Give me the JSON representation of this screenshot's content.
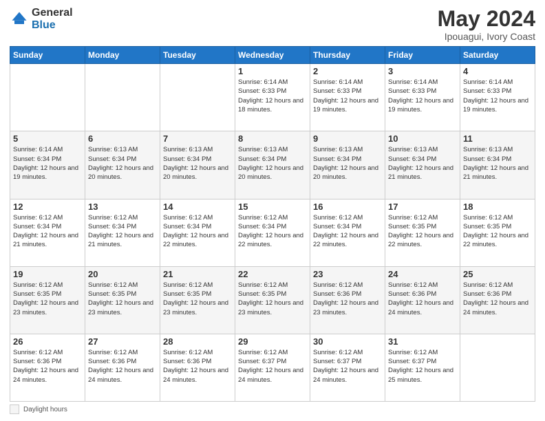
{
  "logo": {
    "general": "General",
    "blue": "Blue"
  },
  "title": "May 2024",
  "subtitle": "Ipouagui, Ivory Coast",
  "days_header": [
    "Sunday",
    "Monday",
    "Tuesday",
    "Wednesday",
    "Thursday",
    "Friday",
    "Saturday"
  ],
  "footer": {
    "daylight_label": "Daylight hours"
  },
  "weeks": [
    [
      {
        "day": "",
        "info": ""
      },
      {
        "day": "",
        "info": ""
      },
      {
        "day": "",
        "info": ""
      },
      {
        "day": "1",
        "info": "Sunrise: 6:14 AM\nSunset: 6:33 PM\nDaylight: 12 hours\nand 18 minutes."
      },
      {
        "day": "2",
        "info": "Sunrise: 6:14 AM\nSunset: 6:33 PM\nDaylight: 12 hours\nand 19 minutes."
      },
      {
        "day": "3",
        "info": "Sunrise: 6:14 AM\nSunset: 6:33 PM\nDaylight: 12 hours\nand 19 minutes."
      },
      {
        "day": "4",
        "info": "Sunrise: 6:14 AM\nSunset: 6:33 PM\nDaylight: 12 hours\nand 19 minutes."
      }
    ],
    [
      {
        "day": "5",
        "info": "Sunrise: 6:14 AM\nSunset: 6:34 PM\nDaylight: 12 hours\nand 19 minutes."
      },
      {
        "day": "6",
        "info": "Sunrise: 6:13 AM\nSunset: 6:34 PM\nDaylight: 12 hours\nand 20 minutes."
      },
      {
        "day": "7",
        "info": "Sunrise: 6:13 AM\nSunset: 6:34 PM\nDaylight: 12 hours\nand 20 minutes."
      },
      {
        "day": "8",
        "info": "Sunrise: 6:13 AM\nSunset: 6:34 PM\nDaylight: 12 hours\nand 20 minutes."
      },
      {
        "day": "9",
        "info": "Sunrise: 6:13 AM\nSunset: 6:34 PM\nDaylight: 12 hours\nand 20 minutes."
      },
      {
        "day": "10",
        "info": "Sunrise: 6:13 AM\nSunset: 6:34 PM\nDaylight: 12 hours\nand 21 minutes."
      },
      {
        "day": "11",
        "info": "Sunrise: 6:13 AM\nSunset: 6:34 PM\nDaylight: 12 hours\nand 21 minutes."
      }
    ],
    [
      {
        "day": "12",
        "info": "Sunrise: 6:12 AM\nSunset: 6:34 PM\nDaylight: 12 hours\nand 21 minutes."
      },
      {
        "day": "13",
        "info": "Sunrise: 6:12 AM\nSunset: 6:34 PM\nDaylight: 12 hours\nand 21 minutes."
      },
      {
        "day": "14",
        "info": "Sunrise: 6:12 AM\nSunset: 6:34 PM\nDaylight: 12 hours\nand 22 minutes."
      },
      {
        "day": "15",
        "info": "Sunrise: 6:12 AM\nSunset: 6:34 PM\nDaylight: 12 hours\nand 22 minutes."
      },
      {
        "day": "16",
        "info": "Sunrise: 6:12 AM\nSunset: 6:34 PM\nDaylight: 12 hours\nand 22 minutes."
      },
      {
        "day": "17",
        "info": "Sunrise: 6:12 AM\nSunset: 6:35 PM\nDaylight: 12 hours\nand 22 minutes."
      },
      {
        "day": "18",
        "info": "Sunrise: 6:12 AM\nSunset: 6:35 PM\nDaylight: 12 hours\nand 22 minutes."
      }
    ],
    [
      {
        "day": "19",
        "info": "Sunrise: 6:12 AM\nSunset: 6:35 PM\nDaylight: 12 hours\nand 23 minutes."
      },
      {
        "day": "20",
        "info": "Sunrise: 6:12 AM\nSunset: 6:35 PM\nDaylight: 12 hours\nand 23 minutes."
      },
      {
        "day": "21",
        "info": "Sunrise: 6:12 AM\nSunset: 6:35 PM\nDaylight: 12 hours\nand 23 minutes."
      },
      {
        "day": "22",
        "info": "Sunrise: 6:12 AM\nSunset: 6:35 PM\nDaylight: 12 hours\nand 23 minutes."
      },
      {
        "day": "23",
        "info": "Sunrise: 6:12 AM\nSunset: 6:36 PM\nDaylight: 12 hours\nand 23 minutes."
      },
      {
        "day": "24",
        "info": "Sunrise: 6:12 AM\nSunset: 6:36 PM\nDaylight: 12 hours\nand 24 minutes."
      },
      {
        "day": "25",
        "info": "Sunrise: 6:12 AM\nSunset: 6:36 PM\nDaylight: 12 hours\nand 24 minutes."
      }
    ],
    [
      {
        "day": "26",
        "info": "Sunrise: 6:12 AM\nSunset: 6:36 PM\nDaylight: 12 hours\nand 24 minutes."
      },
      {
        "day": "27",
        "info": "Sunrise: 6:12 AM\nSunset: 6:36 PM\nDaylight: 12 hours\nand 24 minutes."
      },
      {
        "day": "28",
        "info": "Sunrise: 6:12 AM\nSunset: 6:36 PM\nDaylight: 12 hours\nand 24 minutes."
      },
      {
        "day": "29",
        "info": "Sunrise: 6:12 AM\nSunset: 6:37 PM\nDaylight: 12 hours\nand 24 minutes."
      },
      {
        "day": "30",
        "info": "Sunrise: 6:12 AM\nSunset: 6:37 PM\nDaylight: 12 hours\nand 24 minutes."
      },
      {
        "day": "31",
        "info": "Sunrise: 6:12 AM\nSunset: 6:37 PM\nDaylight: 12 hours\nand 25 minutes."
      },
      {
        "day": "",
        "info": ""
      }
    ]
  ]
}
